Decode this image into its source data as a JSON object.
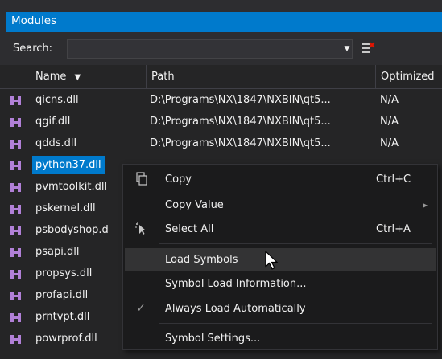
{
  "window": {
    "title": "Modules"
  },
  "search": {
    "label": "Search:",
    "value": "",
    "dropdown_icon": "chevron-down-icon",
    "clear_icon": "clear-search-icon"
  },
  "columns": {
    "name": "Name",
    "path": "Path",
    "optimized": "Optimized",
    "sort_icon": "sort-descending-icon"
  },
  "rows": [
    {
      "name": "qicns.dll",
      "path": "D:\\Programs\\NX\\1847\\NXBIN\\qt5...",
      "optimized": "N/A"
    },
    {
      "name": "qgif.dll",
      "path": "D:\\Programs\\NX\\1847\\NXBIN\\qt5...",
      "optimized": "N/A"
    },
    {
      "name": "qdds.dll",
      "path": "D:\\Programs\\NX\\1847\\NXBIN\\qt5...",
      "optimized": "N/A"
    },
    {
      "name": "python37.dll",
      "path": "",
      "optimized": ""
    },
    {
      "name": "pvmtoolkit.dll",
      "path": "",
      "optimized": ""
    },
    {
      "name": "pskernel.dll",
      "path": "",
      "optimized": ""
    },
    {
      "name": "psbodyshop.d",
      "path": "",
      "optimized": ""
    },
    {
      "name": "psapi.dll",
      "path": "",
      "optimized": ""
    },
    {
      "name": "propsys.dll",
      "path": "",
      "optimized": ""
    },
    {
      "name": "profapi.dll",
      "path": "",
      "optimized": ""
    },
    {
      "name": "prntvpt.dll",
      "path": "",
      "optimized": ""
    },
    {
      "name": "powrprof.dll",
      "path": "",
      "optimized": ""
    }
  ],
  "selected_row": 3,
  "context_menu": {
    "items": [
      {
        "label": "Copy",
        "shortcut": "Ctrl+C",
        "icon": "copy-icon"
      },
      {
        "label": "Copy Value",
        "shortcut": "",
        "icon": "",
        "submenu": true
      },
      {
        "label": "Select All",
        "shortcut": "Ctrl+A",
        "icon": "select-all-icon"
      },
      {
        "label": "Load Symbols",
        "shortcut": "",
        "icon": ""
      },
      {
        "label": "Symbol Load Information...",
        "shortcut": "",
        "icon": ""
      },
      {
        "label": "Always Load Automatically",
        "shortcut": "",
        "icon": "checkmark-icon",
        "checked": true
      },
      {
        "label": "Symbol Settings...",
        "shortcut": "",
        "icon": ""
      }
    ],
    "hovered": "Load Symbols"
  },
  "colors": {
    "accent": "#007acc",
    "background": "#252526",
    "menu_bg": "#1b1b1c",
    "module_icon": "#b180d7"
  }
}
